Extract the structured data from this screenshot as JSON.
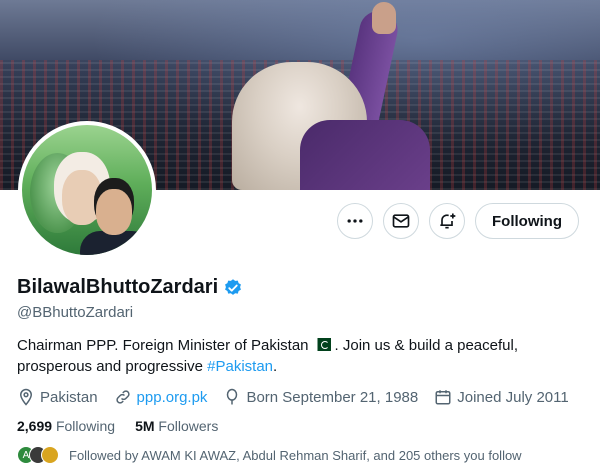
{
  "profile": {
    "display_name": "BilawalBhuttoZardari",
    "handle": "@BBhuttoZardari",
    "bio_part1": "Chairman PPP. Foreign Minister of Pakistan",
    "bio_part2": ". Join us & build a peaceful, prosperous and progressive",
    "bio_hashtag": "#Pakistan",
    "bio_end": ".",
    "location": "Pakistan",
    "website": "ppp.org.pk",
    "born": "Born September 21, 1988",
    "joined": "Joined July 2011"
  },
  "stats": {
    "following_count": "2,699",
    "following_label": "Following",
    "followers_count": "5M",
    "followers_label": "Followers"
  },
  "followed_by": {
    "text": "Followed by AWAM KI AWAZ, Abdul Rehman Sharif, and 205 others you follow",
    "avatar_letter": "A"
  },
  "actions": {
    "more_icon": "more-icon",
    "message_icon": "mail-icon",
    "notify_icon": "bell-plus-icon",
    "follow_label": "Following"
  },
  "colors": {
    "accent": "#1d9bf0",
    "secondary_text": "#536471",
    "border": "#cfd9de"
  }
}
